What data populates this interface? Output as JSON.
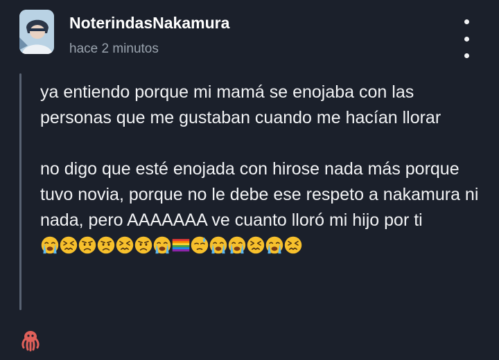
{
  "post": {
    "username": "NoterindasNakamura",
    "timestamp": "hace 2 minutos",
    "menu_icon": "more-vertical-icon",
    "paragraph1": "ya entiendo porque mi mamá se enojaba con las personas que me gustaban cuando me hacían llorar",
    "paragraph2": "no digo que esté enojada con hirose nada más porque tuvo novia, porque no le debe ese respeto a nakamura ni nada, pero AAAAAAA ve cuanto lloró mi hijo por ti",
    "emoji_sequence": [
      "😭",
      "😣",
      "😠",
      "😠",
      "😣",
      "😠",
      "😭",
      "🏳️‍🌈",
      "😓",
      "😭",
      "😭",
      "😣",
      "😭",
      "😣"
    ]
  },
  "footer": {
    "icon": "octopus-icon"
  },
  "colors": {
    "background": "#1b202b",
    "text": "#f2f3f5",
    "muted": "#9aa3ae",
    "quote_bar": "#586272"
  }
}
